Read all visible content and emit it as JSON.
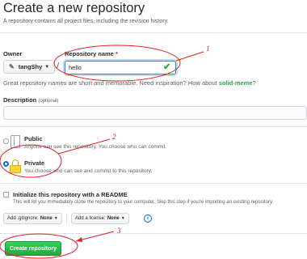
{
  "header": {
    "title": "Create a new repository",
    "subtitle": "A repository contains all project files, including the revision history."
  },
  "owner": {
    "label": "Owner",
    "value": "tangShy"
  },
  "repository_name": {
    "label": "Repository name",
    "required_mark": "*",
    "value": "hello",
    "valid_icon": "check-icon"
  },
  "hint": {
    "text": "Great repository names are short and memorable. Need inspiration? How about",
    "suggestion": "solid-meme",
    "end": "?"
  },
  "description": {
    "label": "Description",
    "optional": "(optional)",
    "value": ""
  },
  "visibility": {
    "public": {
      "title": "Public",
      "desc": "Anyone can see this repository. You choose who can commit.",
      "selected": false
    },
    "private": {
      "title": "Private",
      "desc": "You choose who can see and commit to this repository.",
      "selected": true
    }
  },
  "readme": {
    "label": "Initialize this repository with a README",
    "desc": "This will let you immediately clone the repository to your computer. Skip this step if you're importing an existing repository.",
    "checked": false
  },
  "gitignore": {
    "prefix": "Add .gitignore:",
    "value": "None"
  },
  "license": {
    "prefix": "Add a license:",
    "value": "None"
  },
  "info_icon": "i",
  "submit": {
    "label": "Create repository"
  },
  "annotations": {
    "n1": "1",
    "n2": "2",
    "n3": "3"
  },
  "colors": {
    "accent_blue": "#0366d6",
    "success_green": "#28a745",
    "annotation_red": "#e02020",
    "lock_yellow": "#ffd33d"
  }
}
